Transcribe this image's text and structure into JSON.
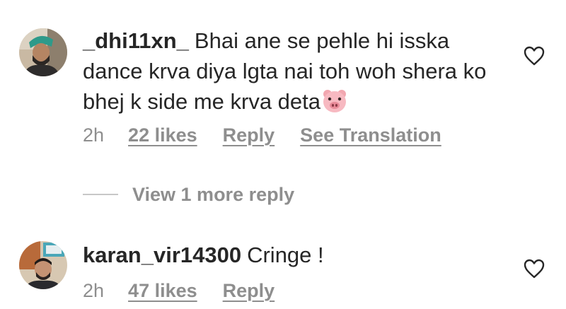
{
  "comments": [
    {
      "username": "_dhi11xn_",
      "text": "Bhai ane se pehle hi isska dance krva diya lgta nai toh woh shera ko bhej k side me krva deta",
      "emoji": "pig-face",
      "time": "2h",
      "likes": "22 likes",
      "reply": "Reply",
      "translate": "See Translation"
    },
    {
      "username": "karan_vir14300",
      "text": "Cringe !",
      "time": "2h",
      "likes": "47 likes",
      "reply": "Reply"
    }
  ],
  "view_replies": "View 1 more reply",
  "colors": {
    "primary_text": "#262626",
    "secondary_text": "#8e8e8e",
    "divider": "#c7c7c7"
  }
}
